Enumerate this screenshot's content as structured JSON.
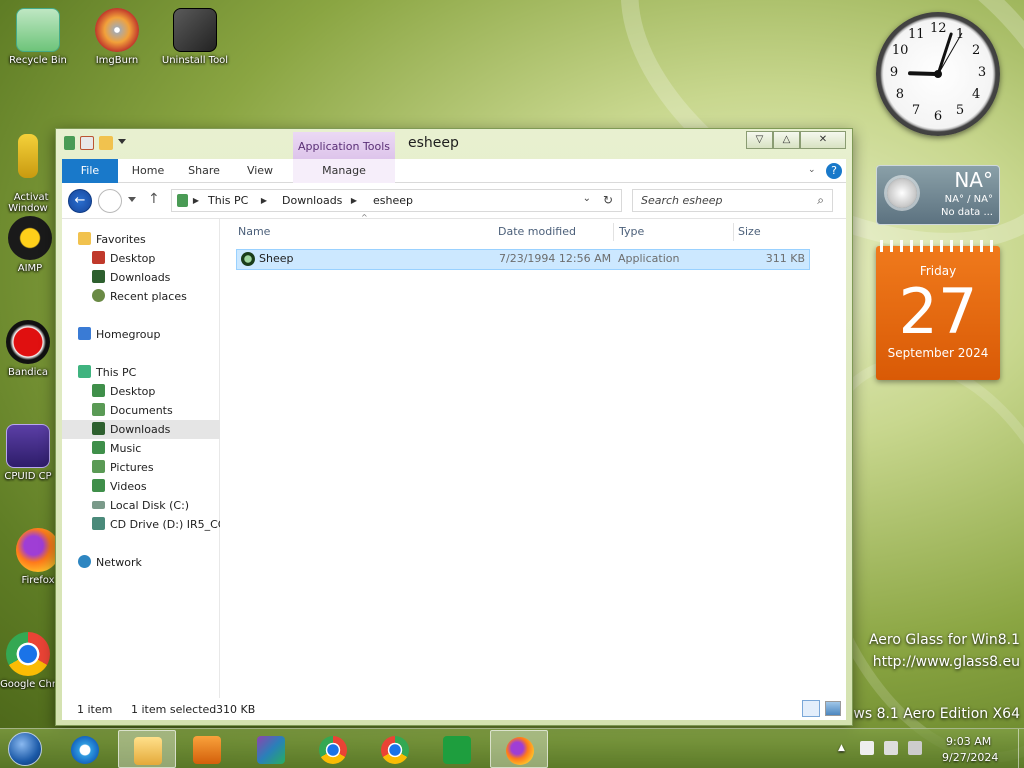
{
  "desktop": {
    "icons": [
      {
        "label": "Recycle Bin",
        "icon": "recycle-bin-icon"
      },
      {
        "label": "ImgBurn",
        "icon": "imgburn-icon"
      },
      {
        "label": "Uninstall Tool",
        "icon": "uninstall-tool-icon"
      },
      {
        "label": "Activat\nWindow",
        "icon": "key-icon"
      },
      {
        "label": "AIMP",
        "icon": "aimp-icon"
      },
      {
        "label": "Bandica",
        "icon": "bandicam-icon"
      },
      {
        "label": "CPUID CP",
        "icon": "cpuid-icon"
      },
      {
        "label": "Firefox",
        "icon": "firefox-icon"
      },
      {
        "label": "Google Chr",
        "icon": "chrome-icon"
      }
    ],
    "aero_text": {
      "line1": "Aero Glass for Win8.1",
      "line2": "http://www.glass8.eu",
      "line3": "ws 8.1 Aero Edition X64"
    }
  },
  "gadgets": {
    "clock": {
      "numbers": [
        "12",
        "1",
        "2",
        "3",
        "4",
        "5",
        "6",
        "7",
        "8",
        "9",
        "10",
        "11"
      ]
    },
    "weather": {
      "temp": "NA°",
      "range": "NA° / NA°",
      "status": "No data ..."
    },
    "calendar": {
      "weekday": "Friday",
      "day": "27",
      "month_year": "September 2024"
    }
  },
  "window": {
    "title": "esheep",
    "context_tab_group": "Application Tools",
    "ribbon_tabs": [
      "File",
      "Home",
      "Share",
      "View",
      "Manage"
    ],
    "breadcrumb": [
      "This PC",
      "Downloads",
      "esheep"
    ],
    "search_placeholder": "Search esheep",
    "navigation": {
      "favorites": "Favorites",
      "favorites_items": [
        "Desktop",
        "Downloads",
        "Recent places"
      ],
      "homegroup": "Homegroup",
      "this_pc": "This PC",
      "this_pc_items": [
        "Desktop",
        "Documents",
        "Downloads",
        "Music",
        "Pictures",
        "Videos",
        "Local Disk (C:)",
        "CD Drive (D:) IR5_CCS"
      ],
      "network": "Network"
    },
    "columns": [
      "Name",
      "Date modified",
      "Type",
      "Size"
    ],
    "files": [
      {
        "name": "Sheep",
        "date_modified": "7/23/1994 12:56 AM",
        "type": "Application",
        "size": "311 KB"
      }
    ],
    "status": {
      "item_count": "1 item",
      "selection": "1 item selected",
      "selection_size": "310 KB"
    }
  },
  "taskbar": {
    "apps": [
      "start-button",
      "internet-explorer-icon",
      "file-explorer-icon",
      "media-player-icon",
      "winrar-icon",
      "chrome-icon",
      "chrome-alt-icon",
      "store-icon",
      "firefox-icon"
    ],
    "time": "9:03 AM",
    "date": "9/27/2024"
  },
  "colors": {
    "accent": "#1979ca",
    "selection": "#cce8ff",
    "calendar": "#e8690f"
  }
}
